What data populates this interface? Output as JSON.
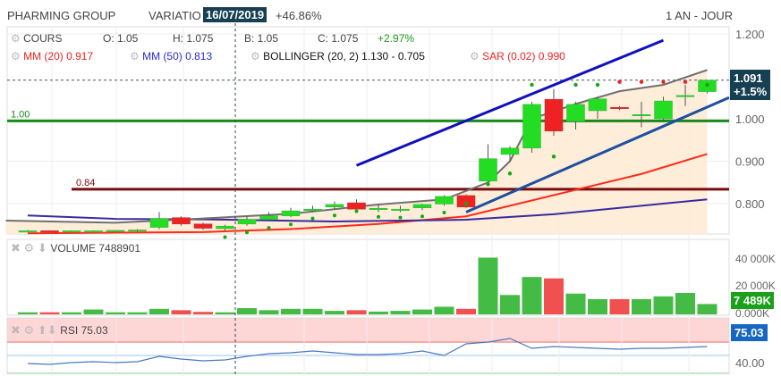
{
  "header": {
    "title": "PHARMING GROUP",
    "variation_label": "VARIATIO",
    "date": "16/07/2019",
    "variation": "+46.86%",
    "period": "1 AN - JOUR"
  },
  "legend": {
    "cours": "COURS",
    "o": "O: 1.05",
    "h": "H: 1.075",
    "b": "B: 1.05",
    "c": "C: 1.075",
    "chg": "+2.97%",
    "mm20": "MM (20) 0.917",
    "mm50": "MM (50) 0.813",
    "boll": "BOLLINGER (20, 2) 1.130 - 0.705",
    "sar": "SAR (0.02) 0.990"
  },
  "price_tag": {
    "value": "1.091",
    "change": "+1.5%"
  },
  "volume": {
    "label": "VOLUME 7488901",
    "tag": "7 489K",
    "ticks": [
      "40 000K",
      "20 000K",
      "0.000K"
    ]
  },
  "rsi": {
    "label": "RSI 75.03",
    "tag": "75.03",
    "ticks": [
      "40.00"
    ]
  },
  "colors": {
    "up": "#22dd22",
    "down": "#ee2222",
    "mm20": "#ff2a1a",
    "mm50": "#3a2aa0",
    "boll": "#707070",
    "trend": "#1010c0"
  },
  "chart_data": {
    "type": "candlestick",
    "ylim": [
      0.728,
      1.22
    ],
    "yticks": [
      "1.200",
      "1.000",
      "0.900",
      "0.800"
    ],
    "ytick_values": [
      1.2,
      1.0,
      0.9,
      0.8
    ],
    "hlines": [
      {
        "label": "1.00",
        "value": 0.995,
        "color": "#1a8a1a"
      },
      {
        "label": "0.84",
        "value": 0.834,
        "color": "#7a0d0d"
      }
    ],
    "candles": [
      [
        0.735,
        0.738,
        0.733,
        0.736
      ],
      [
        0.736,
        0.737,
        0.734,
        0.735
      ],
      [
        0.735,
        0.737,
        0.733,
        0.736
      ],
      [
        0.734,
        0.737,
        0.732,
        0.736
      ],
      [
        0.736,
        0.738,
        0.733,
        0.737
      ],
      [
        0.735,
        0.74,
        0.733,
        0.738
      ],
      [
        0.744,
        0.78,
        0.74,
        0.765
      ],
      [
        0.767,
        0.77,
        0.748,
        0.752
      ],
      [
        0.752,
        0.755,
        0.738,
        0.742
      ],
      [
        0.741,
        0.75,
        0.736,
        0.747
      ],
      [
        0.752,
        0.77,
        0.748,
        0.763
      ],
      [
        0.763,
        0.78,
        0.758,
        0.771
      ],
      [
        0.771,
        0.79,
        0.768,
        0.783
      ],
      [
        0.785,
        0.795,
        0.78,
        0.787
      ],
      [
        0.792,
        0.805,
        0.788,
        0.798
      ],
      [
        0.802,
        0.81,
        0.785,
        0.787
      ],
      [
        0.789,
        0.8,
        0.78,
        0.789
      ],
      [
        0.787,
        0.795,
        0.78,
        0.787
      ],
      [
        0.79,
        0.8,
        0.785,
        0.798
      ],
      [
        0.799,
        0.82,
        0.795,
        0.817
      ],
      [
        0.819,
        0.822,
        0.79,
        0.792
      ],
      [
        0.853,
        0.94,
        0.85,
        0.906
      ],
      [
        0.916,
        0.935,
        0.9,
        0.931
      ],
      [
        0.931,
        1.04,
        0.92,
        1.034
      ],
      [
        1.046,
        1.07,
        0.96,
        0.971
      ],
      [
        0.994,
        1.04,
        0.975,
        1.034
      ],
      [
        1.019,
        1.05,
        1.0,
        1.047
      ],
      [
        1.027,
        1.03,
        1.02,
        1.025
      ],
      [
        1.01,
        1.04,
        0.98,
        1.01
      ],
      [
        1.0,
        1.052,
        0.995,
        1.042
      ],
      [
        1.055,
        1.08,
        1.03,
        1.055
      ],
      [
        1.064,
        1.07,
        1.06,
        1.091
      ]
    ],
    "series": [
      {
        "name": "MM (20)",
        "color": "#ff2a1a",
        "points": [
          [
            0,
            0.73
          ],
          [
            8,
            0.733
          ],
          [
            12,
            0.74
          ],
          [
            16,
            0.752
          ],
          [
            20,
            0.77
          ],
          [
            24,
            0.82
          ],
          [
            28,
            0.87
          ],
          [
            31,
            0.917
          ]
        ]
      },
      {
        "name": "MM (50)",
        "color": "#3a2aa0",
        "points": [
          [
            0,
            0.772
          ],
          [
            4,
            0.764
          ],
          [
            8,
            0.763
          ],
          [
            14,
            0.758
          ],
          [
            20,
            0.762
          ],
          [
            24,
            0.775
          ],
          [
            28,
            0.795
          ],
          [
            31,
            0.81
          ]
        ]
      },
      {
        "name": "Bollinger",
        "color": "#707070",
        "points": [
          [
            -1,
            0.76
          ],
          [
            4,
            0.755
          ],
          [
            8,
            0.765
          ],
          [
            12,
            0.776
          ],
          [
            16,
            0.798
          ],
          [
            19,
            0.81
          ],
          [
            21,
            0.85
          ],
          [
            22,
            0.9
          ],
          [
            23,
            1.0
          ],
          [
            25,
            1.035
          ],
          [
            27,
            1.065
          ],
          [
            29,
            1.08
          ],
          [
            31,
            1.115
          ]
        ]
      },
      {
        "name": "Trend high",
        "color": "#1010c0",
        "points": [
          [
            15,
            0.89
          ],
          [
            29,
            1.185
          ]
        ]
      },
      {
        "name": "Trend low",
        "color": "#1f4fa0",
        "points": [
          [
            20,
            0.78
          ],
          [
            32,
            1.05
          ]
        ]
      }
    ],
    "volumes": [
      1500,
      1500,
      1500,
      3500,
      1500,
      1500,
      4000,
      3000,
      1800,
      1500,
      4500,
      3000,
      4000,
      4000,
      2500,
      3000,
      2000,
      2500,
      3500,
      5500,
      4000,
      41000,
      14000,
      27000,
      26000,
      15000,
      11000,
      11000,
      11000,
      13000,
      15500,
      7489
    ],
    "rsi": [
      41,
      40,
      42,
      43,
      42,
      43,
      49,
      46,
      44,
      45,
      49,
      52,
      53,
      55,
      53,
      51,
      51,
      52,
      55,
      50,
      63,
      65,
      69,
      58,
      60,
      59,
      58,
      57,
      58,
      58,
      59,
      60
    ]
  }
}
